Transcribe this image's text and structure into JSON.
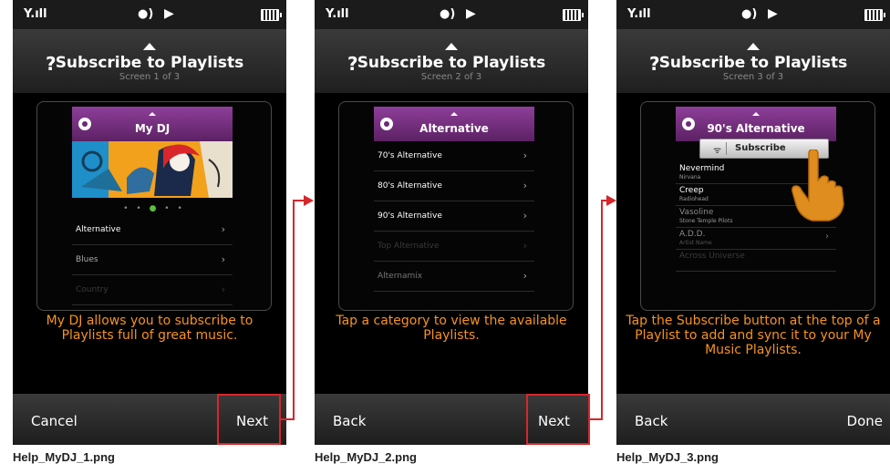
{
  "screens": [
    {
      "status": {
        "signal": "Y.ıll",
        "voice": "●)",
        "play": "▶"
      },
      "header": {
        "help": "?",
        "title": "Subscribe to Playlists",
        "subtitle": "Screen 1 of 3"
      },
      "card_title": "My DJ",
      "list": [
        "Alternative",
        "Blues",
        "Country"
      ],
      "caption": "My DJ allows you to subscribe to Playlists full of great music.",
      "left_button": "Cancel",
      "right_button": "Next",
      "filename": "Help_MyDJ_1.png"
    },
    {
      "status": {
        "signal": "Y.ıll",
        "voice": "●)",
        "play": "▶"
      },
      "header": {
        "help": "?",
        "title": "Subscribe to Playlists",
        "subtitle": "Screen 2 of 3"
      },
      "card_title": "Alternative",
      "list": [
        "70's Alternative",
        "80's Alternative",
        "90's Alternative",
        "Top Alternative",
        "Alternamix"
      ],
      "caption": "Tap a category to view the available Playlists.",
      "left_button": "Back",
      "right_button": "Next",
      "filename": "Help_MyDJ_2.png"
    },
    {
      "status": {
        "signal": "Y.ıll",
        "voice": "●)",
        "play": "▶"
      },
      "header": {
        "help": "?",
        "title": "Subscribe to Playlists",
        "subtitle": "Screen 3 of 3"
      },
      "card_title": "90's Alternative",
      "subscribe": "Subscribe",
      "songs": [
        {
          "title": "Nevermind",
          "artist": "Nirvana"
        },
        {
          "title": "Creep",
          "artist": "Radiohead"
        },
        {
          "title": "Vasoline",
          "artist": "Stone Temple Pilots"
        },
        {
          "title": "A.D.D.",
          "artist": "Artist Name"
        },
        {
          "title": "Across Universe",
          "artist": ""
        }
      ],
      "caption": "Tap the Subscribe button at the top of a Playlist to add and sync it to your My Music Playlists.",
      "left_button": "Back",
      "right_button": "Done",
      "filename": "Help_MyDJ_3.png"
    }
  ],
  "colors": {
    "accent_purple": "#7a2f85",
    "caption_orange": "#f7931e",
    "highlight_red": "#d7262b"
  },
  "glyphs": {
    "chevron": "›",
    "wifi": "ᯤ",
    "dots": "• • ● • •"
  }
}
